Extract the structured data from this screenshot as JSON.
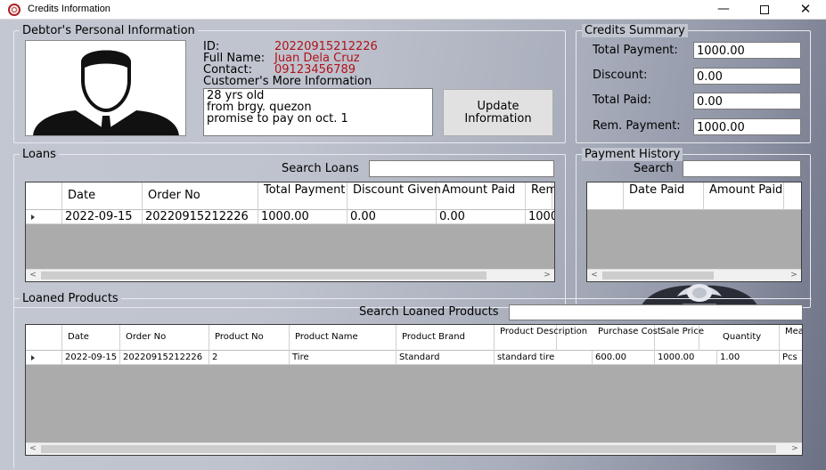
{
  "window": {
    "title": "Credits Information",
    "minimize": "—",
    "close": "✕"
  },
  "debtor": {
    "legend": "Debtor's Personal Information",
    "id_label": "ID:",
    "id_value": "20220915212226",
    "name_label": "Full Name:",
    "name_value": "Juan Dela Cruz",
    "contact_label": "Contact:",
    "contact_value": "09123456789",
    "more_label": "Customer's More Information",
    "more_lines": [
      "28 yrs old",
      "from brgy. quezon",
      "promise to pay on oct. 1"
    ],
    "update_button": "Update Information"
  },
  "summary": {
    "legend": "Credits Summary",
    "rows": [
      {
        "label": "Total Payment:",
        "value": "1000.00"
      },
      {
        "label": "Discount:",
        "value": "0.00"
      },
      {
        "label": "Total Paid:",
        "value": "0.00"
      },
      {
        "label": "Rem. Payment:",
        "value": "1000.00"
      }
    ]
  },
  "loans": {
    "legend": "Loans",
    "search_label": "Search Loans",
    "search_value": "",
    "columns": [
      "Date",
      "Order No",
      "Total Payment",
      "Discount Given",
      "Amount Paid",
      "Rem Pay"
    ],
    "rows": [
      [
        "2022-09-15",
        "20220915212226",
        "1000.00",
        "0.00",
        "0.00",
        "1000"
      ]
    ]
  },
  "history": {
    "legend": "Payment History",
    "search_label": "Search",
    "search_value": "",
    "columns": [
      "Date Paid",
      "Amount Paid"
    ]
  },
  "products": {
    "legend": "Loaned Products",
    "search_label": "Search Loaned Products",
    "search_value": "",
    "columns": [
      "Date",
      "Order No",
      "Product No",
      "Product Name",
      "Product Brand",
      "Product Description",
      "Purchase Cost",
      "Sale Price",
      "Quantity",
      "Mea Unit"
    ],
    "rows": [
      [
        "2022-09-15",
        "20220915212226",
        "2",
        "Tire",
        "Standard",
        "standard tire",
        "600.00",
        "1000.00",
        "1.00",
        "Pcs"
      ]
    ]
  },
  "scroll": {
    "left": "<",
    "right": ">"
  }
}
